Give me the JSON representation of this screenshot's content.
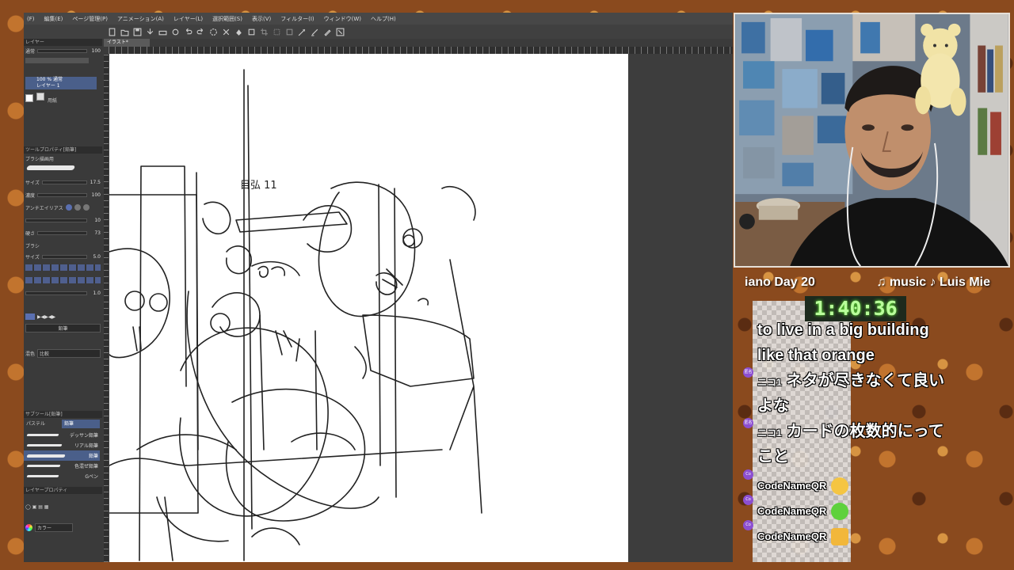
{
  "app": {
    "menu": [
      "(F)",
      "編集(E)",
      "ページ管理(P)",
      "アニメーション(A)",
      "レイヤー(L)",
      "選択範囲(S)",
      "表示(V)",
      "フィルター(I)",
      "ウィンドウ(W)",
      "ヘルプ(H)"
    ],
    "doc_tab": "イラスト*",
    "layer_panel": {
      "header": "レイヤー",
      "blend_mode": "通常",
      "opacity": "100",
      "layers": [
        {
          "label": "100 % 通常\nレイヤー 1",
          "selected": true
        },
        {
          "label": "用紙",
          "selected": false
        }
      ]
    },
    "tool_property": {
      "header": "ツールプロパティ[鉛筆]",
      "subheader": "ブラシ描画用",
      "params": [
        {
          "label": "サイズ",
          "value": "17.5"
        },
        {
          "label": "濃度",
          "value": "100"
        },
        {
          "label": "アンチエイリアス",
          "value": ""
        },
        {
          "label": "",
          "value": "10"
        },
        {
          "label": "硬さ",
          "value": "73"
        },
        {
          "label": "ブラシ",
          "value": ""
        },
        {
          "label": "サイズ",
          "value": "5.0"
        }
      ],
      "extra_value": "1.0",
      "mix_mode": "比較",
      "mix_label": "混色",
      "pencil_group": "鉛筆"
    },
    "sub_tool": {
      "header": "サブツール[鉛筆]",
      "tabs": [
        "鉛筆",
        "パステル"
      ],
      "items": [
        "デッサン鉛筆",
        "リアル鉛筆",
        "鉛筆",
        "色混ぜ鉛筆",
        "Gペン"
      ]
    },
    "layer_property": {
      "header": "レイヤープロパティ",
      "color_label": "カラー"
    },
    "sketch_note": "目弘 11"
  },
  "stream": {
    "ticker_left": "iano Day 20",
    "ticker_right": "♫ music ♪ Luis Mie",
    "timer": "1:40:36",
    "chat": [
      {
        "kind": "big",
        "text": "to live in a big building"
      },
      {
        "kind": "big",
        "text": "like that orange"
      },
      {
        "kind": "big",
        "prefix": "ニコ1",
        "text": "ネタが尽きなくて良い",
        "badge": "匿名"
      },
      {
        "kind": "big",
        "text": "よな"
      },
      {
        "kind": "big",
        "prefix": "ニコ1",
        "text": "カードの枚数的にって",
        "badge": "匿名"
      },
      {
        "kind": "big",
        "text": "こと"
      },
      {
        "kind": "small",
        "text": "CodeNameQR",
        "badge": "Co",
        "emoji_color": "#f5c542"
      },
      {
        "kind": "small",
        "text": "CodeNameQR",
        "badge": "Co",
        "emoji_color": "#5ed13c"
      },
      {
        "kind": "small",
        "text": "CodeNameQR",
        "badge": "Co",
        "emoji_color": "#f2b73a"
      }
    ]
  }
}
